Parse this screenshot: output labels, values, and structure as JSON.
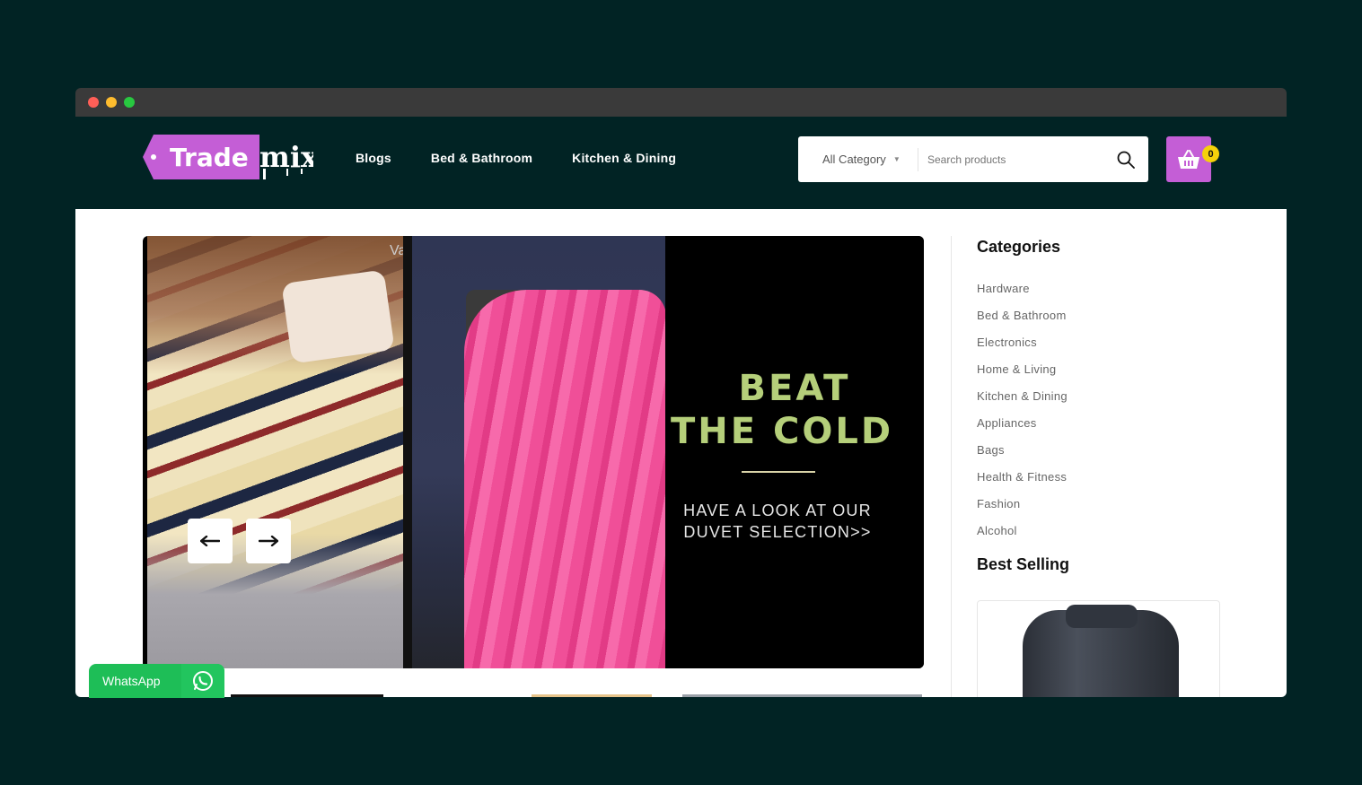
{
  "browser": {
    "dot_colors": [
      "#ff5f57",
      "#febc2e",
      "#28c840"
    ]
  },
  "header": {
    "logo_text_1": "Trade",
    "logo_text_2": "mix",
    "nav": [
      "Blogs",
      "Bed & Bathroom",
      "Kitchen & Dining"
    ],
    "search": {
      "category": "All Category",
      "placeholder": "Search products"
    },
    "cart_count": "0",
    "accent_color": "#c45ed6"
  },
  "slider": {
    "headline_1": "BEAT",
    "headline_2": "THE COLD",
    "subline_1": "HAVE A LOOK AT OUR",
    "subline_2": "DUVET SELECTION>>",
    "watermark": "Va",
    "prev_icon": "arrow-left-icon",
    "next_icon": "arrow-right-icon"
  },
  "sidebar": {
    "categories_title": "Categories",
    "categories": [
      "Hardware",
      "Bed & Bathroom",
      "Electronics",
      "Home & Living",
      "Kitchen & Dining",
      "Appliances",
      "Bags",
      "Health & Fitness",
      "Fashion",
      "Alcohol"
    ],
    "best_selling_title": "Best Selling"
  },
  "whatsapp": {
    "label": "WhatsApp",
    "color": "#1ebe57"
  }
}
